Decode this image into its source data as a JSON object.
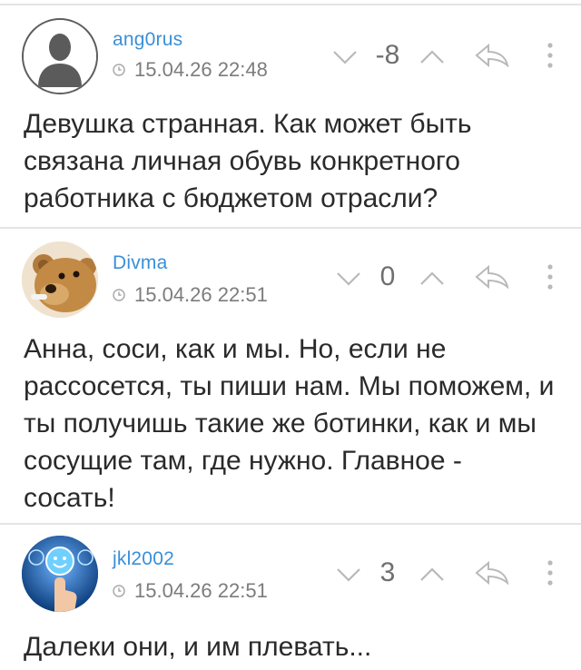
{
  "comments": [
    {
      "username": "ang0rus",
      "timestamp": "15.04.26 22:48",
      "score": "-8",
      "text": "Девушка странная. Как может быть связана личная обувь конкретного работника с бюджетом отрасли?",
      "avatar_icon": "default-user-silhouette-icon"
    },
    {
      "username": "Divma",
      "timestamp": "15.04.26 22:51",
      "score": "0",
      "text": "Анна, соси, как и мы. Но, если не рассосется, ты пиши нам. Мы поможем, и ты получишь такие же ботинки, как и мы сосущие там, где нужно. Главное - сосать!",
      "avatar_icon": "teddy-bear-photo-icon"
    },
    {
      "username": "jkl2002",
      "timestamp": "15.04.26 22:51",
      "score": "3",
      "text": "Далеки они, и им плевать...",
      "avatar_icon": "smiley-finger-photo-icon"
    }
  ],
  "colors": {
    "username": "#3a8fd8",
    "text": "#2a2a2a",
    "meta": "#7c7c7c",
    "icon": "#b9b9b9",
    "divider": "#e4e4e4"
  }
}
